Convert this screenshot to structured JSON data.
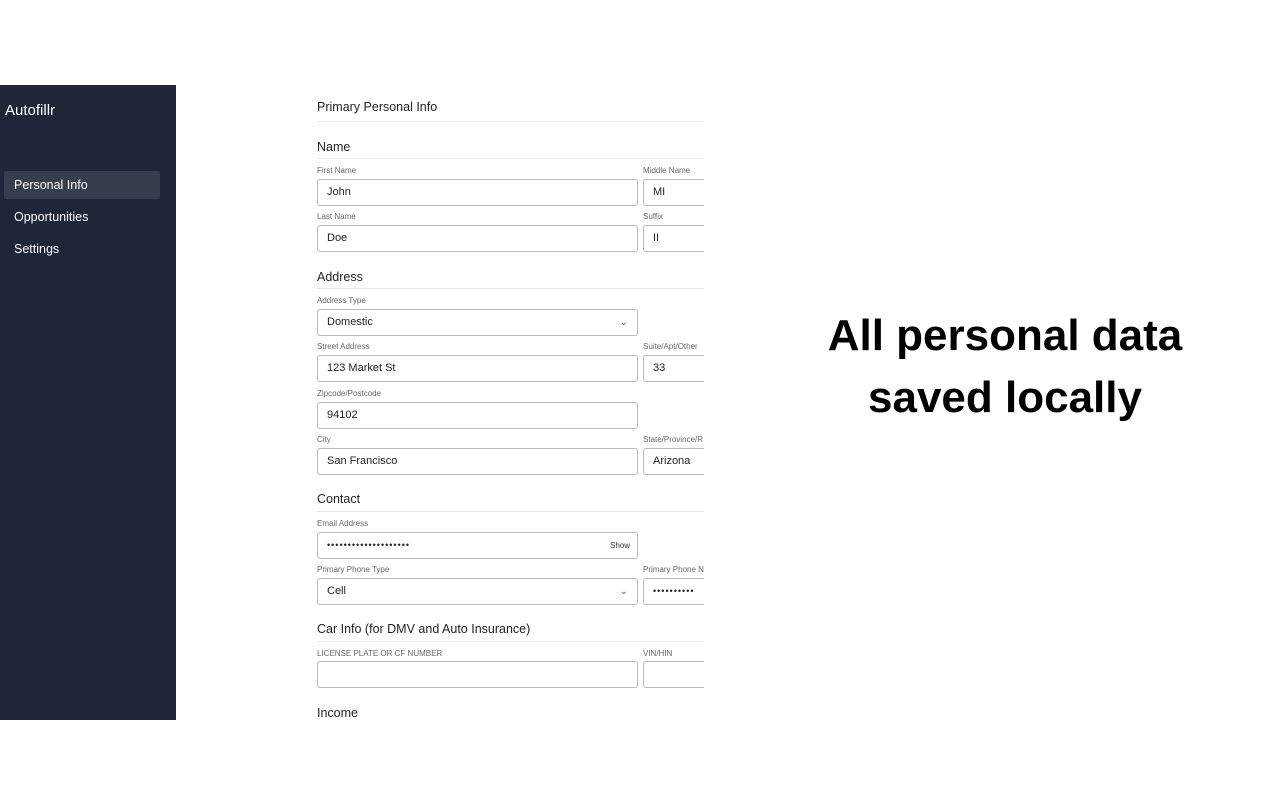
{
  "sidebar": {
    "brand": "Autofillr",
    "items": [
      {
        "label": "Personal Info",
        "active": true
      },
      {
        "label": "Opportunities"
      },
      {
        "label": "Settings"
      }
    ],
    "bg": "#1f2637"
  },
  "form": {
    "title": "Primary Personal Info",
    "name": {
      "heading": "Name",
      "first_label": "First Name",
      "first": "John",
      "middle_label": "Middle Name",
      "middle": "MI",
      "last_label": "Last Name",
      "last": "Doe",
      "suffix_label": "Suffix",
      "suffix": "II"
    },
    "address": {
      "heading": "Address",
      "type_label": "Address Type",
      "type": "Domestic",
      "street_label": "Street Address",
      "street": "123 Market St",
      "suite_label": "Suite/Apt/Other",
      "suite": "33",
      "zip_label": "Zipcode/Postcode",
      "zip": "94102",
      "city_label": "City",
      "city": "San Francisco",
      "state_label": "State/Province/R",
      "state": "Arizona"
    },
    "contact": {
      "heading": "Contact",
      "email_label": "Email Address",
      "email_masked": "••••••••••••••••••••",
      "show_label": "Show",
      "phone_type_label": "Primary Phone Type",
      "phone_type": "Cell",
      "phone_label": "Primary Phone N",
      "phone_masked": "••••••••••"
    },
    "car": {
      "heading": "Car Info (for DMV and Auto Insurance)",
      "plate_label": "LICENSE PLATE OR CF NUMBER",
      "plate": "",
      "vin_label": "VIN/HIN",
      "vin": ""
    },
    "income": {
      "heading": "Income"
    }
  },
  "tagline": {
    "line1": "All personal data",
    "line2": "saved locally"
  }
}
